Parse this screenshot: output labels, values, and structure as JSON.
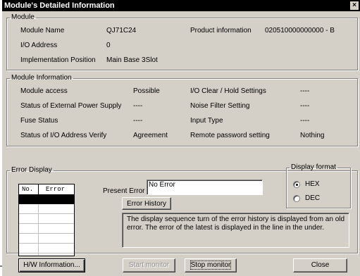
{
  "window": {
    "title": "Module's Detailed Information",
    "close_glyph": "×"
  },
  "module": {
    "legend": "Module",
    "name_label": "Module Name",
    "name_value": "QJ71C24",
    "io_label": "I/O Address",
    "io_value": "0",
    "impl_label": "Implementation Position",
    "impl_value": "Main Base  3Slot",
    "product_label": "Product information",
    "product_value": "020510000000000 - B"
  },
  "module_info": {
    "legend": "Module Information",
    "rows_left": [
      {
        "label": "Module access",
        "value": "Possible"
      },
      {
        "label": "Status of External Power Supply",
        "value": "----"
      },
      {
        "label": "Fuse Status",
        "value": "----"
      },
      {
        "label": "Status of I/O Address Verify",
        "value": "Agreement"
      }
    ],
    "rows_right": [
      {
        "label": "I/O Clear / Hold Settings",
        "value": "----"
      },
      {
        "label": "Noise Filter Setting",
        "value": "----"
      },
      {
        "label": "Input Type",
        "value": "----"
      },
      {
        "label": "Remote password setting",
        "value": "Nothing"
      }
    ]
  },
  "error_display": {
    "legend": "Error Display",
    "table_headers": [
      "No.",
      "Error"
    ],
    "present_error_label": "Present Error",
    "present_error_value": "No Error",
    "error_history_button": "Error History",
    "note": "The display sequence turn of the error history is displayed from an old error. The error of the latest is displayed in the line in the under.",
    "format_legend": "Display format",
    "format_options": [
      "HEX",
      "DEC"
    ],
    "format_selected": "HEX"
  },
  "buttons": {
    "hw_info": "H/W Information...",
    "start_monitor": "Start monitor",
    "stop_monitor": "Stop monitor",
    "close": "Close"
  }
}
